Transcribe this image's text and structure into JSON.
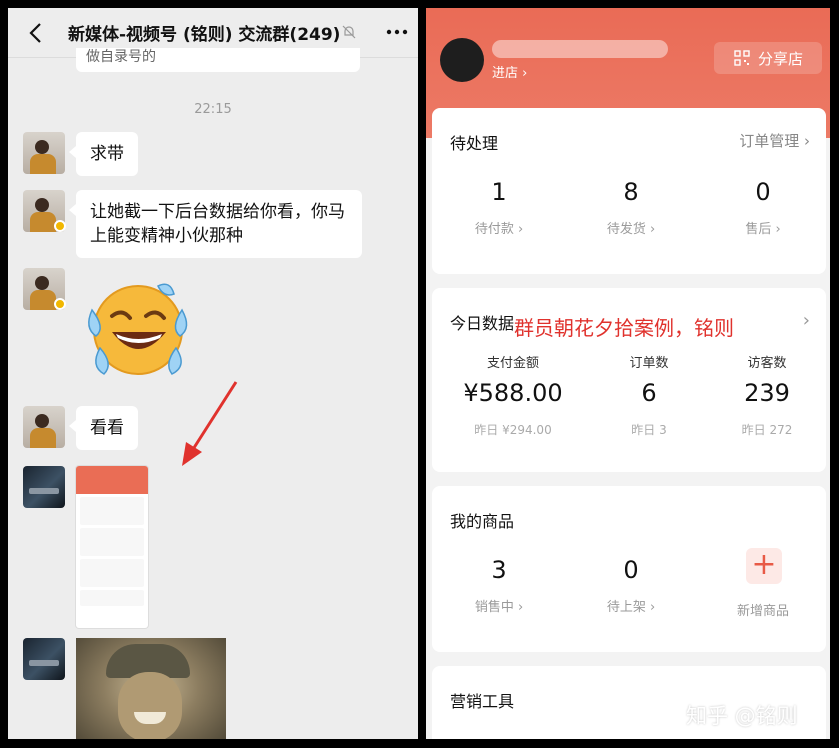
{
  "chat": {
    "title": "新媒体-视频号 (铭则) 交流群(249)",
    "top_message_fragment": "做自录号的",
    "timestamp": "22:15",
    "messages": [
      {
        "text": "求带"
      },
      {
        "text": "让她截一下后台数据给你看，你马上能变精神小伙那种"
      },
      {
        "text": "看看"
      }
    ]
  },
  "shop": {
    "enter_label": "进店 ›",
    "share_label": "分享店",
    "pending": {
      "title": "待处理",
      "link": "订单管理 ›",
      "items": [
        {
          "value": "1",
          "label": "待付款 ›"
        },
        {
          "value": "8",
          "label": "待发货 ›"
        },
        {
          "value": "0",
          "label": "售后 ›"
        }
      ]
    },
    "today": {
      "title": "今日数据",
      "overlay_text": "群员朝花夕拾案例，铭则",
      "chevron": "›",
      "items": [
        {
          "header": "支付金额",
          "value": "¥588.00",
          "yesterday": "昨日 ¥294.00"
        },
        {
          "header": "订单数",
          "value": "6",
          "yesterday": "昨日 3"
        },
        {
          "header": "访客数",
          "value": "239",
          "yesterday": "昨日 272"
        }
      ]
    },
    "products": {
      "title": "我的商品",
      "items": [
        {
          "value": "3",
          "label": "销售中 ›"
        },
        {
          "value": "0",
          "label": "待上架 ›"
        }
      ],
      "add_label": "新增商品",
      "add_symbol": "+"
    },
    "marketing": {
      "title": "营销工具"
    }
  },
  "watermark": "知乎 @铭则",
  "colors": {
    "accent": "#ea6b56",
    "annotation_red": "#e0322d"
  }
}
